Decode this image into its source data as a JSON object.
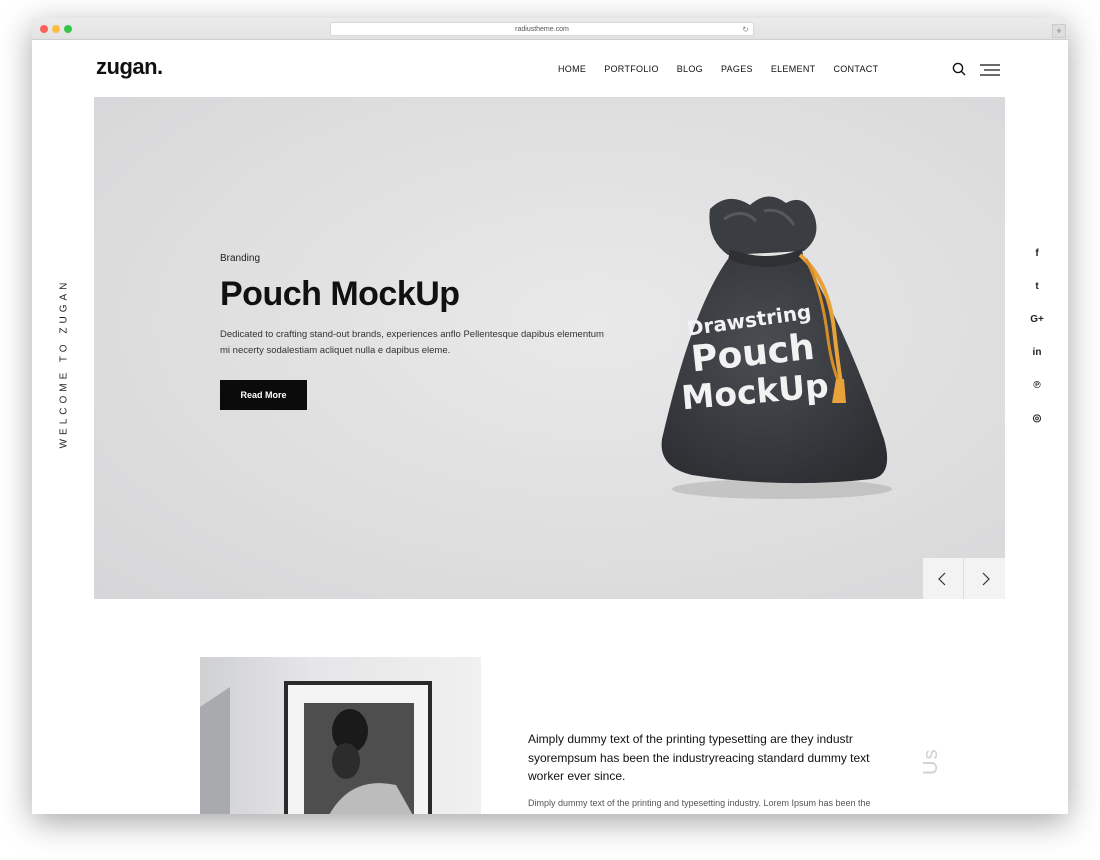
{
  "browser": {
    "url": "radiustheme.com",
    "reload_glyph": "↻",
    "newtab_glyph": "+"
  },
  "header": {
    "logo": "zugan.",
    "nav": [
      "HOME",
      "PORTFOLIO",
      "BLOG",
      "PAGES",
      "ELEMENT",
      "CONTACT"
    ]
  },
  "sidebar_left": {
    "welcome": "WELCOME TO ZUGAN"
  },
  "social": [
    {
      "icon": "facebook-icon",
      "glyph": "f"
    },
    {
      "icon": "twitter-icon",
      "glyph": "t"
    },
    {
      "icon": "google-plus-icon",
      "glyph": "G+"
    },
    {
      "icon": "linkedin-icon",
      "glyph": "in"
    },
    {
      "icon": "pinterest-icon",
      "glyph": "℗"
    },
    {
      "icon": "instagram-icon",
      "glyph": "◎"
    }
  ],
  "hero": {
    "category": "Branding",
    "title": "Pouch MockUp",
    "description": "Dedicated to crafting stand-out brands, experiences anflo Pellentesque dapibus elementum mi necerty sodalestiam acliquet nulla e dapibus eleme.",
    "button": "Read More",
    "pouch_text": [
      "Drawstring",
      "Pouch",
      "MockUp"
    ]
  },
  "about": {
    "lead": "Aimply dummy text of the printing typesetting are they industr syorempsum has been the industryreacing standard dummy text worker ever since.",
    "body": "Dimply dummy text of the printing and typesetting industry. Lorem Ipsum has been the",
    "side_label": "Us"
  },
  "colors": {
    "accent": "#0b0b0b",
    "cord": "#e8a23a",
    "pouch": "#3c3f43"
  }
}
